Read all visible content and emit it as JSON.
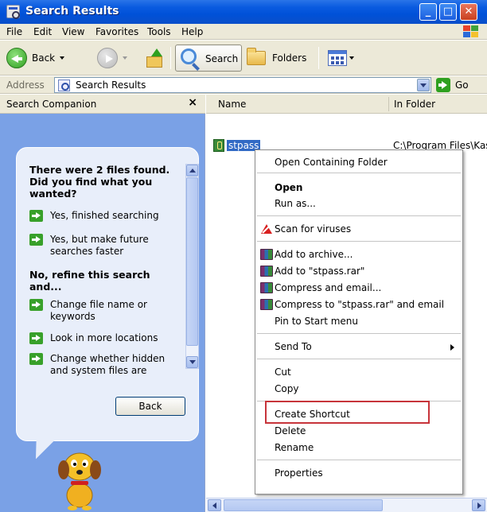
{
  "window": {
    "title": "Search Results"
  },
  "menu": [
    "File",
    "Edit",
    "View",
    "Favorites",
    "Tools",
    "Help"
  ],
  "toolbar": {
    "back_label": "Back",
    "search_label": "Search",
    "folders_label": "Folders"
  },
  "address": {
    "label": "Address",
    "value": "Search Results",
    "go_label": "Go"
  },
  "companion": {
    "title": "Search Companion",
    "close": "×",
    "heading": "There were 2 files found. Did you find what you wanted?",
    "options_yes": [
      "Yes, finished searching",
      "Yes, but make future searches faster"
    ],
    "refine_heading": "No, refine this search and...",
    "refine_options": [
      "Change file name or keywords",
      "Look in more locations",
      "Change whether hidden and system files are"
    ],
    "back_button": "Back"
  },
  "columns": {
    "name": "Name",
    "in_folder": "In Folder"
  },
  "files": [
    {
      "name": "stpass",
      "folder": "C:\\Program Files\\Kas"
    }
  ],
  "context_menu": {
    "items": [
      "Open Containing Folder",
      "Open",
      "Run as...",
      "Scan for viruses",
      "Add to archive...",
      "Add to \"stpass.rar\"",
      "Compress and email...",
      "Compress to \"stpass.rar\" and email",
      "Pin to Start menu",
      "Send To",
      "Cut",
      "Copy",
      "Create Shortcut",
      "Delete",
      "Rename",
      "Properties"
    ]
  },
  "colors": {
    "title_bar": "#0a5be0",
    "highlight": "#c7343a",
    "selection": "#316ac5",
    "task_pane": "#7aa1e6"
  }
}
